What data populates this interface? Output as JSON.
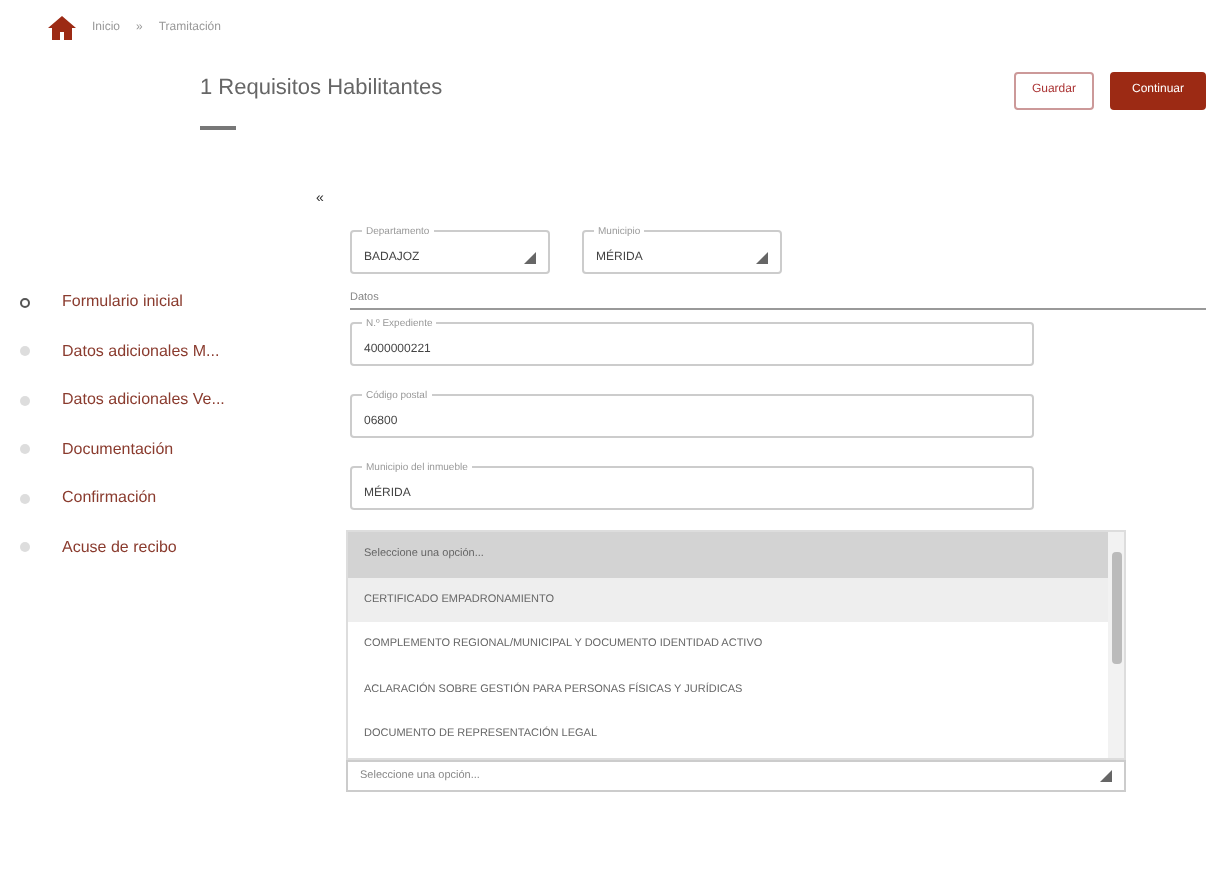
{
  "breadcrumb": [
    "Inicio",
    "»",
    "Tramitación"
  ],
  "title": "1 Requisitos Habilitantes",
  "buttons": [
    {
      "label": "Guardar",
      "kind": "outline"
    },
    {
      "label": "Continuar",
      "kind": "primary"
    }
  ],
  "collapse_toggle": "«",
  "steps": [
    {
      "label": "Formulario inicial",
      "selected": true
    },
    {
      "label": "Datos adicionales M...",
      "selected": false
    },
    {
      "label": "Datos adicionales Ve...",
      "selected": false
    },
    {
      "label": "Documentación",
      "selected": false
    },
    {
      "label": "Confirmación",
      "selected": false
    },
    {
      "label": "Acuse de recibo",
      "selected": false
    }
  ],
  "selects": [
    {
      "label": "Departamento",
      "value": "BADAJOZ"
    },
    {
      "label": "Municipio",
      "value": "MÉRIDA"
    }
  ],
  "section": "Datos",
  "fields": [
    {
      "label": "N.º Expediente",
      "value": "4000000221"
    },
    {
      "label": "Código postal",
      "value": "06800"
    },
    {
      "label": "Municipio del inmueble",
      "value": "MÉRIDA"
    }
  ],
  "dropdown": {
    "options": [
      {
        "label": "Seleccione una opción...",
        "selected": true,
        "hover": false
      },
      {
        "label": "CERTIFICADO EMPADRONAMIENTO",
        "selected": false,
        "hover": true
      },
      {
        "label": "COMPLEMENTO REGIONAL/MUNICIPAL Y DOCUMENTO IDENTIDAD ACTIVO",
        "selected": false,
        "hover": false
      },
      {
        "label": "ACLARACIÓN SOBRE GESTIÓN PARA PERSONAS FÍSICAS Y JURÍDICAS",
        "selected": false,
        "hover": false
      },
      {
        "label": "DOCUMENTO DE REPRESENTACIÓN LEGAL",
        "selected": false,
        "hover": false
      }
    ]
  },
  "bottom_select": {
    "placeholder": "Seleccione una opción..."
  }
}
